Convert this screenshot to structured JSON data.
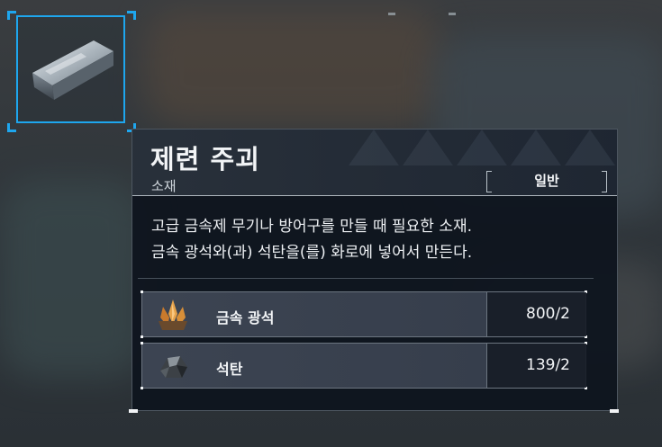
{
  "item": {
    "name": "제련 주괴",
    "category": "소재",
    "grade": "일반",
    "icon": "metal-ingot-icon",
    "description_lines": [
      "고급 금속제 무기나 방어구를 만들 때 필요한 소재.",
      "금속 광석와(과) 석탄을(를) 화로에 넣어서 만든다."
    ]
  },
  "materials": [
    {
      "name": "금속 광석",
      "icon": "metal-ore-icon",
      "quantity": "800/2"
    },
    {
      "name": "석탄",
      "icon": "coal-icon",
      "quantity": "139/2"
    }
  ],
  "colors": {
    "accent": "#1ea6ee",
    "panel": "#0e141e"
  }
}
